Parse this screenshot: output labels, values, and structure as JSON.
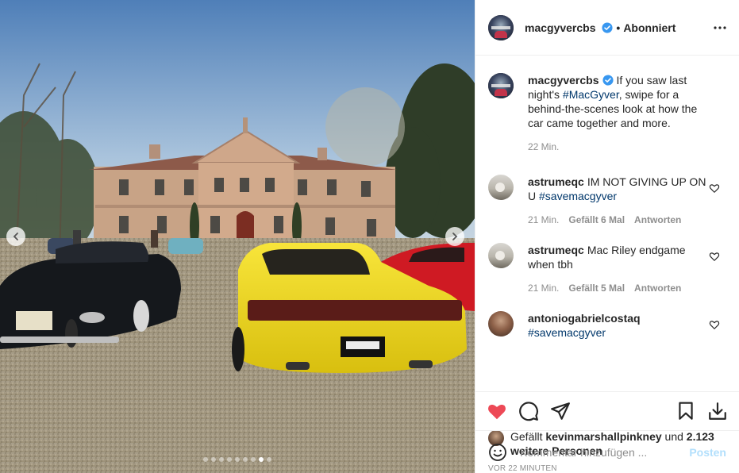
{
  "post": {
    "username": "macgyvercbs",
    "follow_state": "Abonniert",
    "caption": {
      "username": "macgyvercbs",
      "text_before": "If you saw last night's ",
      "hashtag": "#MacGyver",
      "text_after": ", swipe for a behind-the-scenes look at how the car came together and more.",
      "time": "22 Min."
    },
    "comments": [
      {
        "username": "astrumeqc",
        "text": "IM NOT GIVING UP ON U ",
        "hashtag": "#savemacgyver",
        "time": "21 Min.",
        "likes": "Gefällt 6 Mal",
        "reply": "Antworten"
      },
      {
        "username": "astrumeqc",
        "text": "Mac Riley endgame when tbh",
        "time": "21 Min.",
        "likes": "Gefällt 5 Mal",
        "reply": "Antworten"
      },
      {
        "username": "antoniogabrielcostaq",
        "hashtag": "#savemacgyver"
      }
    ],
    "likes": {
      "prefix": "Gefällt ",
      "user": "kevinmarshallpinkney",
      "middle": " und ",
      "others": "2.123 weitere Personen"
    },
    "posted_ago": "VOR 22 MINUTEN",
    "comment_input": {
      "placeholder": "Kommentar hinzufügen ...",
      "submit_label": "Posten"
    },
    "carousel": {
      "total": 9,
      "active_index": 7
    }
  },
  "colors": {
    "like_red": "#ed4956",
    "link_blue": "#00376b",
    "verified_blue": "#3897f0",
    "post_button_disabled": "#b2dffc",
    "meta_gray": "#8e8e8e"
  },
  "icons": {
    "verified": "verified-badge-icon",
    "more": "more-options-icon",
    "like": "heart-icon",
    "comment": "comment-icon",
    "share": "share-icon",
    "save": "bookmark-icon",
    "download": "download-icon",
    "emoji": "emoji-icon",
    "prev": "chevron-left-icon",
    "next": "chevron-right-icon"
  }
}
